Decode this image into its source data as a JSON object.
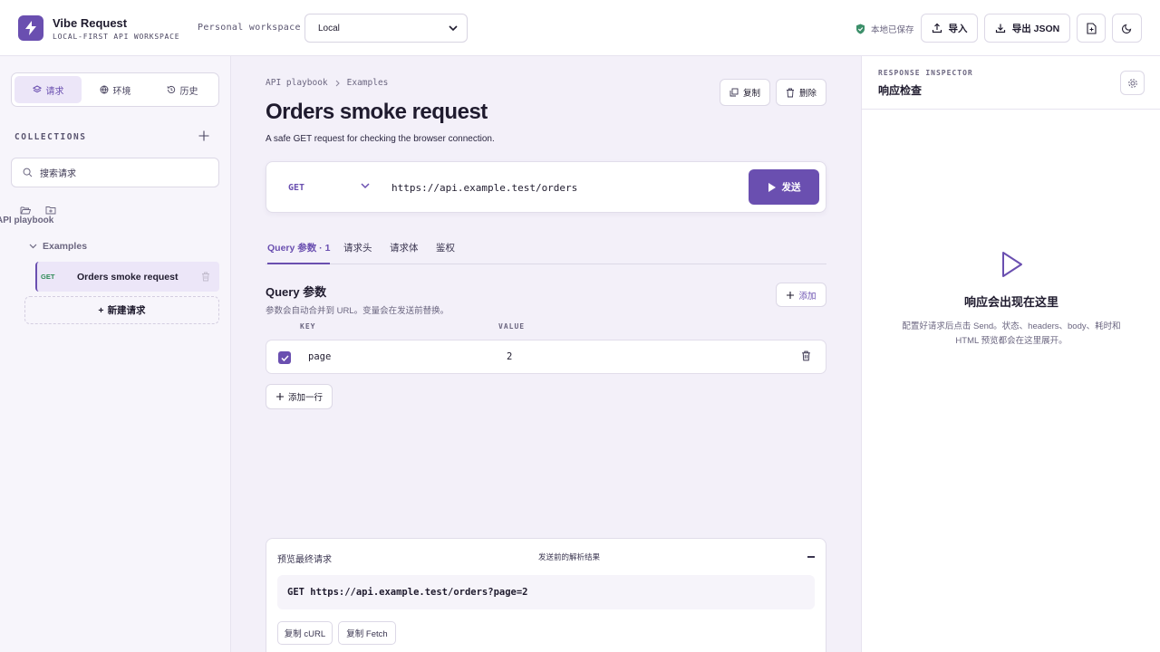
{
  "header": {
    "brand_title": "Vibe Request",
    "brand_subtitle": "LOCAL-FIRST API WORKSPACE",
    "workspace_label": "Personal workspace",
    "workspace_value": "Local",
    "saved_status": "本地已保存",
    "import_label": "导入",
    "export_label": "导出 JSON"
  },
  "sidebar": {
    "tabs": [
      {
        "label": "请求",
        "icon": "layers-icon"
      },
      {
        "label": "环境",
        "icon": "globe-icon"
      },
      {
        "label": "历史",
        "icon": "history-icon"
      }
    ],
    "collections_title": "COLLECTIONS",
    "search_placeholder": "搜索请求",
    "playbook_label": "API playbook",
    "folder_label": "Examples",
    "request_item": {
      "method": "GET",
      "name": "Orders smoke request"
    },
    "new_request_label": "新建请求"
  },
  "main": {
    "breadcrumb": [
      "API playbook",
      "Examples"
    ],
    "copy_label": "复制",
    "delete_label": "删除",
    "title": "Orders smoke request",
    "description": "A safe GET request for checking the browser connection.",
    "method": "GET",
    "url": "https://api.example.test/orders",
    "send_label": "发送",
    "tabs": [
      "Query 参数 · 1",
      "请求头",
      "请求体",
      "鉴权"
    ],
    "section_title": "Query 参数",
    "section_desc": "参数会自动合并到 URL。变量会在发送前替换。",
    "add_label": "添加",
    "col_key": "KEY",
    "col_value": "VALUE",
    "params": [
      {
        "key": "page",
        "value": "2"
      }
    ],
    "add_row_label": "添加一行",
    "preview": {
      "title": "预览最终请求",
      "meta": "发送前的解析结果",
      "code": "GET https://api.example.test/orders?page=2",
      "copy_curl": "复制 cURL",
      "copy_fetch": "复制 Fetch"
    }
  },
  "inspector": {
    "eyebrow": "RESPONSE INSPECTOR",
    "title": "响应检查",
    "empty_title": "响应会出现在这里",
    "empty_desc": "配置好请求后点击 Send。状态、headers、body、耗时和 HTML 预览都会在这里展开。"
  },
  "colors": {
    "accent": "#6a4fb0",
    "get_method": "#2e8a56",
    "saved": "#3c8f6a"
  }
}
